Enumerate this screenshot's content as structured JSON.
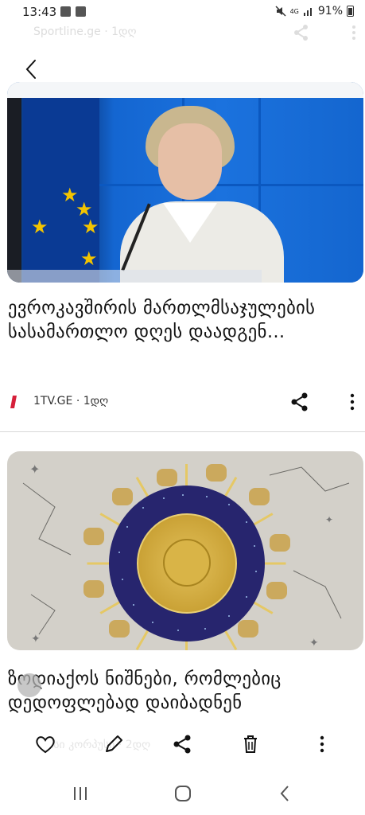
{
  "status_bar": {
    "time": "13:43",
    "network": "4G",
    "battery": "91%"
  },
  "background_row": {
    "source": "Sportline.ge · 1დღ"
  },
  "articles": [
    {
      "headline": "ევროკავშირის მართლმსაჯულების სასამართლო დღეს დაადგენ…",
      "source": "1TV.GE · 1დღ",
      "logo_color": "#d6203a"
    },
    {
      "headline": "ზოდიაქოს ნიშნები, რომლებიც დედოფლებად დაიბადნენ"
    }
  ],
  "background_bottom_row": {
    "source": "ასი კორპუსი · 2დღ"
  },
  "toolbar": {
    "icons": [
      "heart-icon",
      "pencil-icon",
      "share-icon",
      "trash-icon",
      "more-vertical-icon"
    ]
  },
  "navbar": {
    "icons": [
      "recents-icon",
      "home-icon",
      "back-icon"
    ]
  },
  "colors": {
    "accent_blue": "#1466d1",
    "zodiac_navy": "#27256e",
    "gold": "#caa236"
  }
}
